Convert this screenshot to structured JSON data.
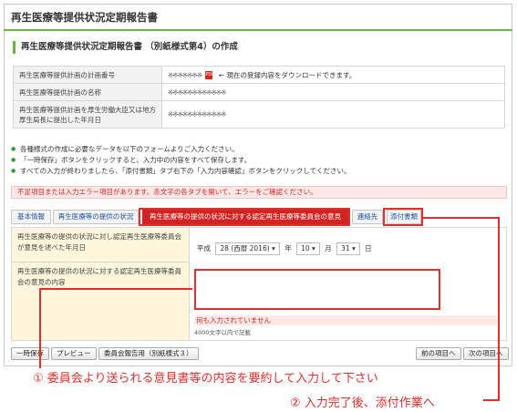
{
  "page_title": "再生医療等提供状況定期報告書",
  "subheading": "再生医療等提供状況定期報告書 （別紙様式第4）の作成",
  "info_table": [
    {
      "label": "再生医療等提供計画の計画番号",
      "value": "※※※※※※※",
      "note": "← 現在の登録内容をダウンロードできます。"
    },
    {
      "label": "再生医療等提供計画の名称",
      "value": "※※※※※※※※※※※※",
      "note": ""
    },
    {
      "label": "再生医療等提供計画を厚生労働大臣又は地方厚生局長に提出した年月日",
      "value": "※※※※※※※※※※※※",
      "note": ""
    }
  ],
  "notes": [
    "各種様式の作成に必要なデータを以下のフォームよりご入力ください。",
    "「一時保存」ボタンをクリックすると、入力中の内容をすべて保存します。",
    "すべての入力が終わりましたら、「添付書類」タブ右下の「入力内容確認」ボタンをクリックしてください。"
  ],
  "error_bar": "不足項目または入力エラー項目があります。赤文字の各タブを開いて、エラーをご確認ください。",
  "tabs": {
    "basic": "基本情報",
    "status": "再生医療等の提供の状況",
    "opinion": "再生医療等の提供の状況に対する認定再生医療等委員会の意見",
    "contact": "連絡先",
    "attach": "添付書類"
  },
  "form": {
    "date_label": "再生医療等の提供の状況に対し認定再生医療等委員会が意見を述べた年月日",
    "era": "平成",
    "year_select": "28 (西暦 2016)",
    "year_unit": "年",
    "month_select": "10",
    "month_unit": "月",
    "day_select": "31",
    "day_unit": "日",
    "opinion_label": "再生医療等の提供の状況に対する認定再生医療等委員会の意見の内容",
    "opinion_value": "",
    "error_msg": "何も入力されていません",
    "char_limit": "4000文字以内で記載"
  },
  "buttons": {
    "save": "一時保存",
    "preview": "プレビュー",
    "report": "委員会報告用（別紙様式３）",
    "prev": "前の項目へ",
    "next": "次の項目へ"
  },
  "annotations": {
    "a1": "① 委員会より送られる意見書等の内容を要約して入力して下さい",
    "a2": "② 入力完了後、添付作業へ"
  },
  "colors": {
    "accent_green": "#6db33f",
    "error_red": "#e0302c",
    "label_yellow": "#fdf6dc"
  }
}
